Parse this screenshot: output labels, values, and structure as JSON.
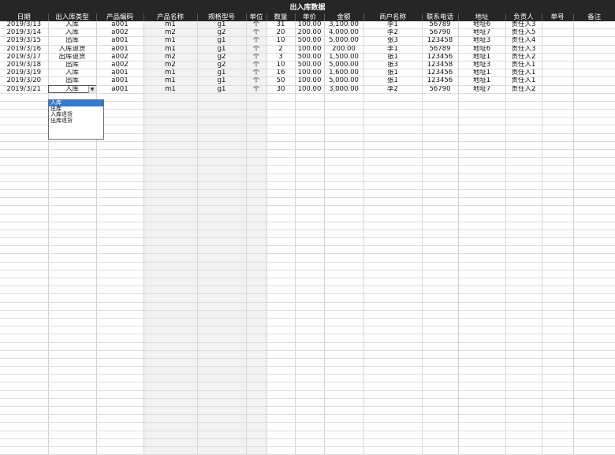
{
  "sheet": {
    "title": "出入库数据",
    "columns": [
      "日期",
      "出入库类型",
      "产品编码",
      "产品名称",
      "规格型号",
      "单位",
      "数量",
      "单价",
      "金额",
      "商户名称",
      "联系电话",
      "地址",
      "负责人",
      "单号",
      "备注"
    ],
    "rows": [
      [
        "2019/3/13",
        "入库",
        "a001",
        "m1",
        "g1",
        "个",
        "31",
        "100.00",
        "3,100.00",
        "李1",
        "56789",
        "地址6",
        "责任人3",
        "",
        ""
      ],
      [
        "2019/3/14",
        "入库",
        "a002",
        "m2",
        "g2",
        "个",
        "20",
        "200.00",
        "4,000.00",
        "李2",
        "56790",
        "地址7",
        "责任人5",
        "",
        ""
      ],
      [
        "2019/3/15",
        "出库",
        "a001",
        "m1",
        "g1",
        "个",
        "10",
        "500.00",
        "5,000.00",
        "张3",
        "123458",
        "地址3",
        "责任人4",
        "",
        ""
      ],
      [
        "2019/3/16",
        "入库退货",
        "a001",
        "m1",
        "g1",
        "个",
        "2",
        "100.00",
        "200.00",
        "李1",
        "56789",
        "地址6",
        "责任人3",
        "",
        ""
      ],
      [
        "2019/3/17",
        "出库退货",
        "a002",
        "m2",
        "g2",
        "个",
        "3",
        "500.00",
        "1,500.00",
        "张1",
        "123456",
        "地址1",
        "责任人2",
        "",
        ""
      ],
      [
        "2019/3/18",
        "出库",
        "a002",
        "m2",
        "g2",
        "个",
        "10",
        "500.00",
        "5,000.00",
        "张3",
        "123458",
        "地址3",
        "责任人1",
        "",
        ""
      ],
      [
        "2019/3/19",
        "入库",
        "a001",
        "m1",
        "g1",
        "个",
        "16",
        "100.00",
        "1,600.00",
        "张1",
        "123456",
        "地址1",
        "责任人1",
        "",
        ""
      ],
      [
        "2019/3/20",
        "出库",
        "a001",
        "m1",
        "g1",
        "个",
        "50",
        "100.00",
        "5,000.00",
        "张1",
        "123456",
        "地址1",
        "责任人1",
        "",
        ""
      ],
      [
        "2019/3/21",
        "入库",
        "a001",
        "m1",
        "g1",
        "个",
        "30",
        "100.00",
        "3,000.00",
        "李2",
        "56790",
        "地址7",
        "责任人2",
        "",
        ""
      ]
    ],
    "empty_rows": 45
  },
  "dropdown": {
    "arrow_icon": "chevron-down-icon",
    "options": [
      "入库",
      "出库",
      "入库退货",
      "出库退货"
    ],
    "selected_index": 0
  },
  "colors": {
    "header_bg": "#262626",
    "header_text": "#ffffff",
    "shaded_column": "#f2f2f2",
    "selection": "#2f7ad6"
  }
}
